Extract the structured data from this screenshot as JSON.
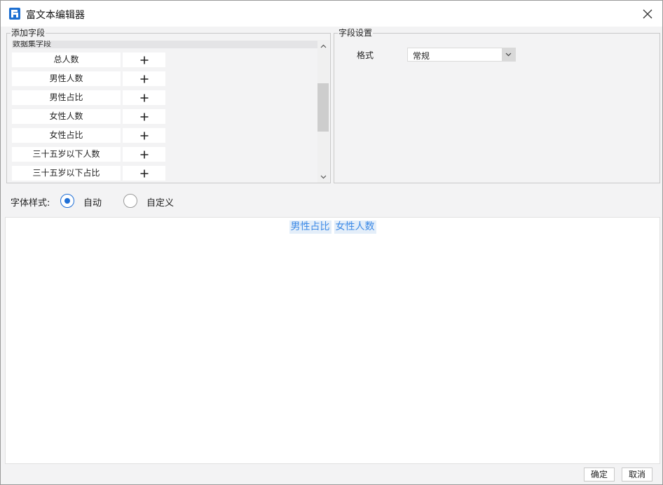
{
  "window": {
    "title": "富文本编辑器"
  },
  "add_field": {
    "legend": "添加字段",
    "dataset_header": "数据集字段",
    "fields": [
      {
        "label": "总人数"
      },
      {
        "label": "男性人数"
      },
      {
        "label": "男性占比"
      },
      {
        "label": "女性人数"
      },
      {
        "label": "女性占比"
      },
      {
        "label": "三十五岁以下人数"
      },
      {
        "label": "三十五岁以下占比"
      }
    ],
    "add_icon": "plus-icon"
  },
  "field_settings": {
    "legend": "字段设置",
    "format_label": "格式",
    "format_value": "常规"
  },
  "font_style": {
    "label": "字体样式:",
    "selected": "自动",
    "options": [
      {
        "label": "自动",
        "checked": true
      },
      {
        "label": "自定义",
        "checked": false
      }
    ]
  },
  "editor": {
    "tokens": [
      "男性占比",
      "女性人数"
    ]
  },
  "footer": {
    "confirm_label": "确定",
    "cancel_label": "取消"
  },
  "colors": {
    "accent": "#1f6fd6",
    "token_text": "#3d8ae6",
    "token_bg": "#e4eef9"
  }
}
